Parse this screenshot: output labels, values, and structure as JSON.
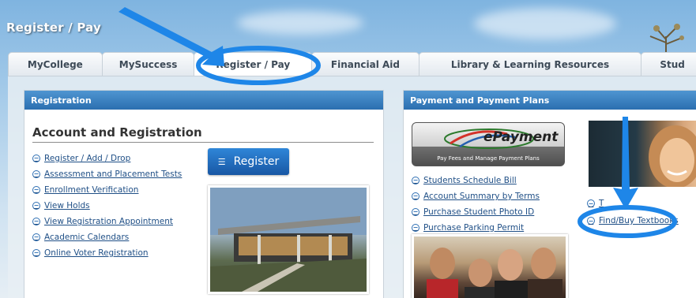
{
  "header": {
    "title": "Register / Pay"
  },
  "tabs": [
    {
      "label": "MyCollege"
    },
    {
      "label": "MySuccess"
    },
    {
      "label": "Register / Pay"
    },
    {
      "label": "Financial Aid"
    },
    {
      "label": "Library & Learning Resources"
    },
    {
      "label": "Stud"
    }
  ],
  "left_panel": {
    "title": "Registration",
    "section_title": "Account and Registration",
    "register_button": "Register",
    "links": [
      "Register / Add / Drop",
      "Assessment and Placement Tests",
      "Enrollment Verification",
      "View Holds",
      "View Registration Appointment",
      "Academic Calendars",
      "Online Voter Registration"
    ]
  },
  "right_panel": {
    "title": "Payment and Payment Plans",
    "epayment": {
      "logo_text": "ePayment",
      "tagline": "Pay Fees and Manage Payment Plans"
    },
    "links": [
      "Students Schedule Bill",
      "Account Summary by Terms",
      "Purchase Student Photo ID",
      "Purchase Parking Permit"
    ],
    "partial_link": "T",
    "textbook_link": "Find/Buy Textbooks"
  },
  "colors": {
    "panel_header": "#2b6fb0",
    "link": "#1f4f86",
    "annotation": "#1e86e8"
  },
  "icons": {
    "link_bullet": "circle-minus-icon",
    "register_menu": "menu-icon"
  }
}
